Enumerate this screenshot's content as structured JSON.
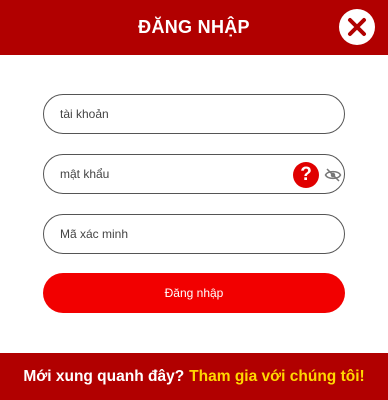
{
  "header": {
    "title": "ĐĂNG NHẬP",
    "close_icon": "close-icon"
  },
  "form": {
    "username_placeholder": "tài khoản",
    "password_placeholder": "mật khẩu",
    "captcha_placeholder": "Mã xác minh",
    "help_icon_glyph": "?",
    "eye_icon": "eye-slash-icon",
    "login_label": "Đăng nhập"
  },
  "footer": {
    "prompt": "Mới xung quanh đây?",
    "signup_link": "Tham gia với chúng tôi!"
  },
  "colors": {
    "brand": "#b10000",
    "button": "#f20000",
    "link": "#ffd700"
  }
}
